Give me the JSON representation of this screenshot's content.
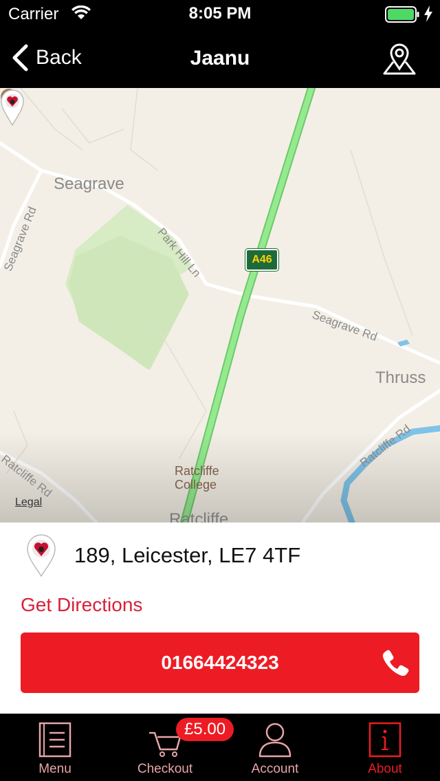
{
  "status_bar": {
    "carrier": "Carrier",
    "time": "8:05 PM",
    "icons": [
      "wifi-icon",
      "battery-icon",
      "charging-icon"
    ]
  },
  "nav": {
    "back_label": "Back",
    "title": "Jaanu",
    "right_icon": "map-pin-outline-icon"
  },
  "map": {
    "place_labels": {
      "seagrave": "Seagrave",
      "thrussington": "Thruss",
      "ratcliffe": "Ratcliffe"
    },
    "road_labels": {
      "seagrave_rd_left": "Seagrave Rd",
      "park_hill_ln": "Park Hill Ln",
      "seagrave_rd_right": "Seagrave Rd",
      "ratcliffe_rd_right": "Ratcliffe Rd",
      "ratcliffe_rd_left": "Ratcliffe Rd"
    },
    "road_shield": "A46",
    "poi": "Ratcliffe\nCollege",
    "legal": "Legal",
    "colors": {
      "land": "#f3efe6",
      "park": "#d7ebc4",
      "highway": "#86e083",
      "water": "#7fc3e8"
    }
  },
  "location": {
    "address": "189, Leicester, LE7 4TF",
    "directions_label": "Get Directions",
    "phone": "01664424323"
  },
  "tab_bar": {
    "tabs": [
      {
        "label": "Menu",
        "icon": "menu-list-icon",
        "active": false
      },
      {
        "label": "Checkout",
        "icon": "cart-icon",
        "active": false
      },
      {
        "label": "Account",
        "icon": "user-icon",
        "active": false
      },
      {
        "label": "About",
        "icon": "info-icon",
        "active": true
      }
    ],
    "checkout_badge": "£5.00"
  },
  "colors": {
    "accent": "#ed1c24",
    "link": "#d8203a",
    "tab_inactive": "#e8a5a9",
    "bar_background": "#000000"
  }
}
